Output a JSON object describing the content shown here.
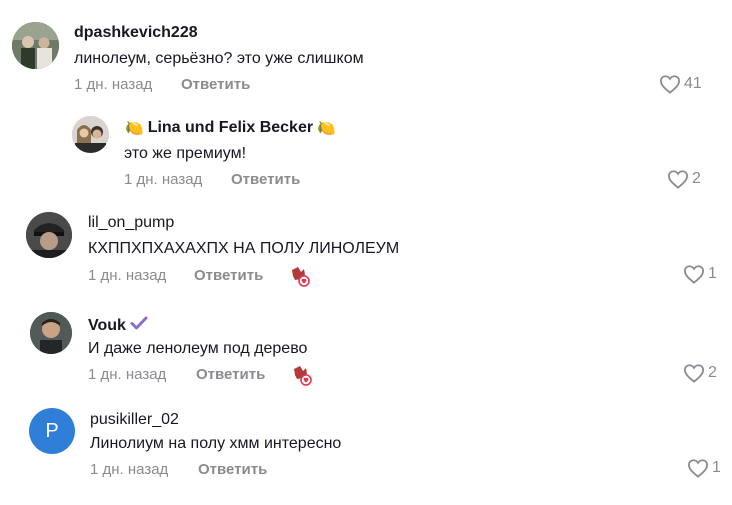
{
  "comments": [
    {
      "username": "dpashkevich228",
      "text": "линолеум, серьёзно? это уже слишком",
      "time": "1 дн. назад",
      "reply_label": "Ответить",
      "likes": "41"
    },
    {
      "username": "Lina und Felix Becker",
      "emoji_left": "🍋",
      "emoji_right": "🍋",
      "text": "это же премиум!",
      "time": "1 дн. назад",
      "reply_label": "Ответить",
      "likes": "2"
    },
    {
      "username": "lil_on_pump",
      "text": "КХППХПХАХАХПХ НА ПОЛУ ЛИНОЛЕУМ",
      "time": "1 дн. назад",
      "reply_label": "Ответить",
      "likes": "1"
    },
    {
      "username": "Vouk",
      "text": "И даже ленолеум под дерево",
      "time": "1 дн. назад",
      "reply_label": "Ответить",
      "likes": "2"
    },
    {
      "username": "pusikiller_02",
      "avatar_letter": "P",
      "text": "Линолиум на полу хмм интересно",
      "time": "1 дн. назад",
      "reply_label": "Ответить",
      "likes": "1"
    }
  ],
  "colors": {
    "meta_text": "#8a8b91",
    "verified_badge": "#8c6bd3",
    "avatar_letter_bg": "#2f7fd8",
    "creator_heart": "#e8344e"
  }
}
